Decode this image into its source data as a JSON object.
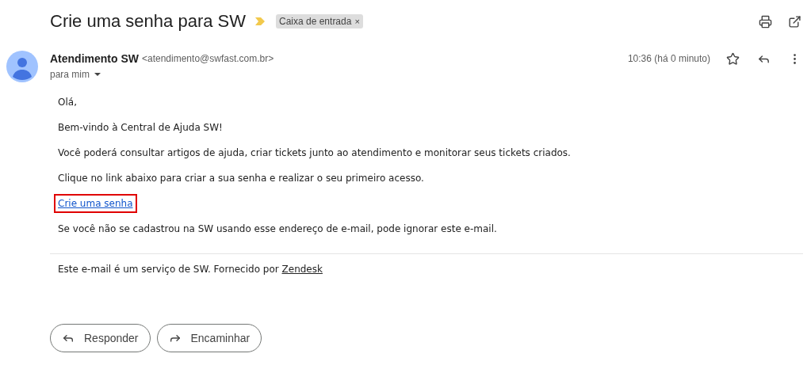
{
  "subject": "Crie uma senha para SW",
  "label": {
    "text": "Caixa de entrada",
    "close": "×"
  },
  "sender": {
    "name": "Atendimento SW",
    "email": "<atendimento@swfast.com.br>",
    "to": "para mim",
    "time": "10:36 (há 0 minuto)",
    "starred": false
  },
  "body": [
    {
      "kind": "text",
      "text": "Olá,"
    },
    {
      "kind": "text",
      "text": "Bem-vindo à Central de Ajuda SW!"
    },
    {
      "kind": "text",
      "text": "Você poderá consultar artigos de ajuda, criar tickets junto ao atendimento e monitorar seus tickets criados."
    },
    {
      "kind": "text",
      "text": "Clique no link abaixo para criar a sua senha e realizar o seu primeiro acesso."
    },
    {
      "kind": "link",
      "text": "Crie uma senha",
      "highlighted": true
    },
    {
      "kind": "text",
      "text": "Se você não se cadastrou na SW usando esse endereço de e-mail, pode ignorar este e-mail."
    }
  ],
  "footer": {
    "text": "Este e-mail é um serviço de SW. Fornecido por ",
    "link": "Zendesk"
  },
  "actions": [
    {
      "kind": "reply",
      "label": "Responder"
    },
    {
      "kind": "forward",
      "label": "Encaminhar"
    }
  ]
}
